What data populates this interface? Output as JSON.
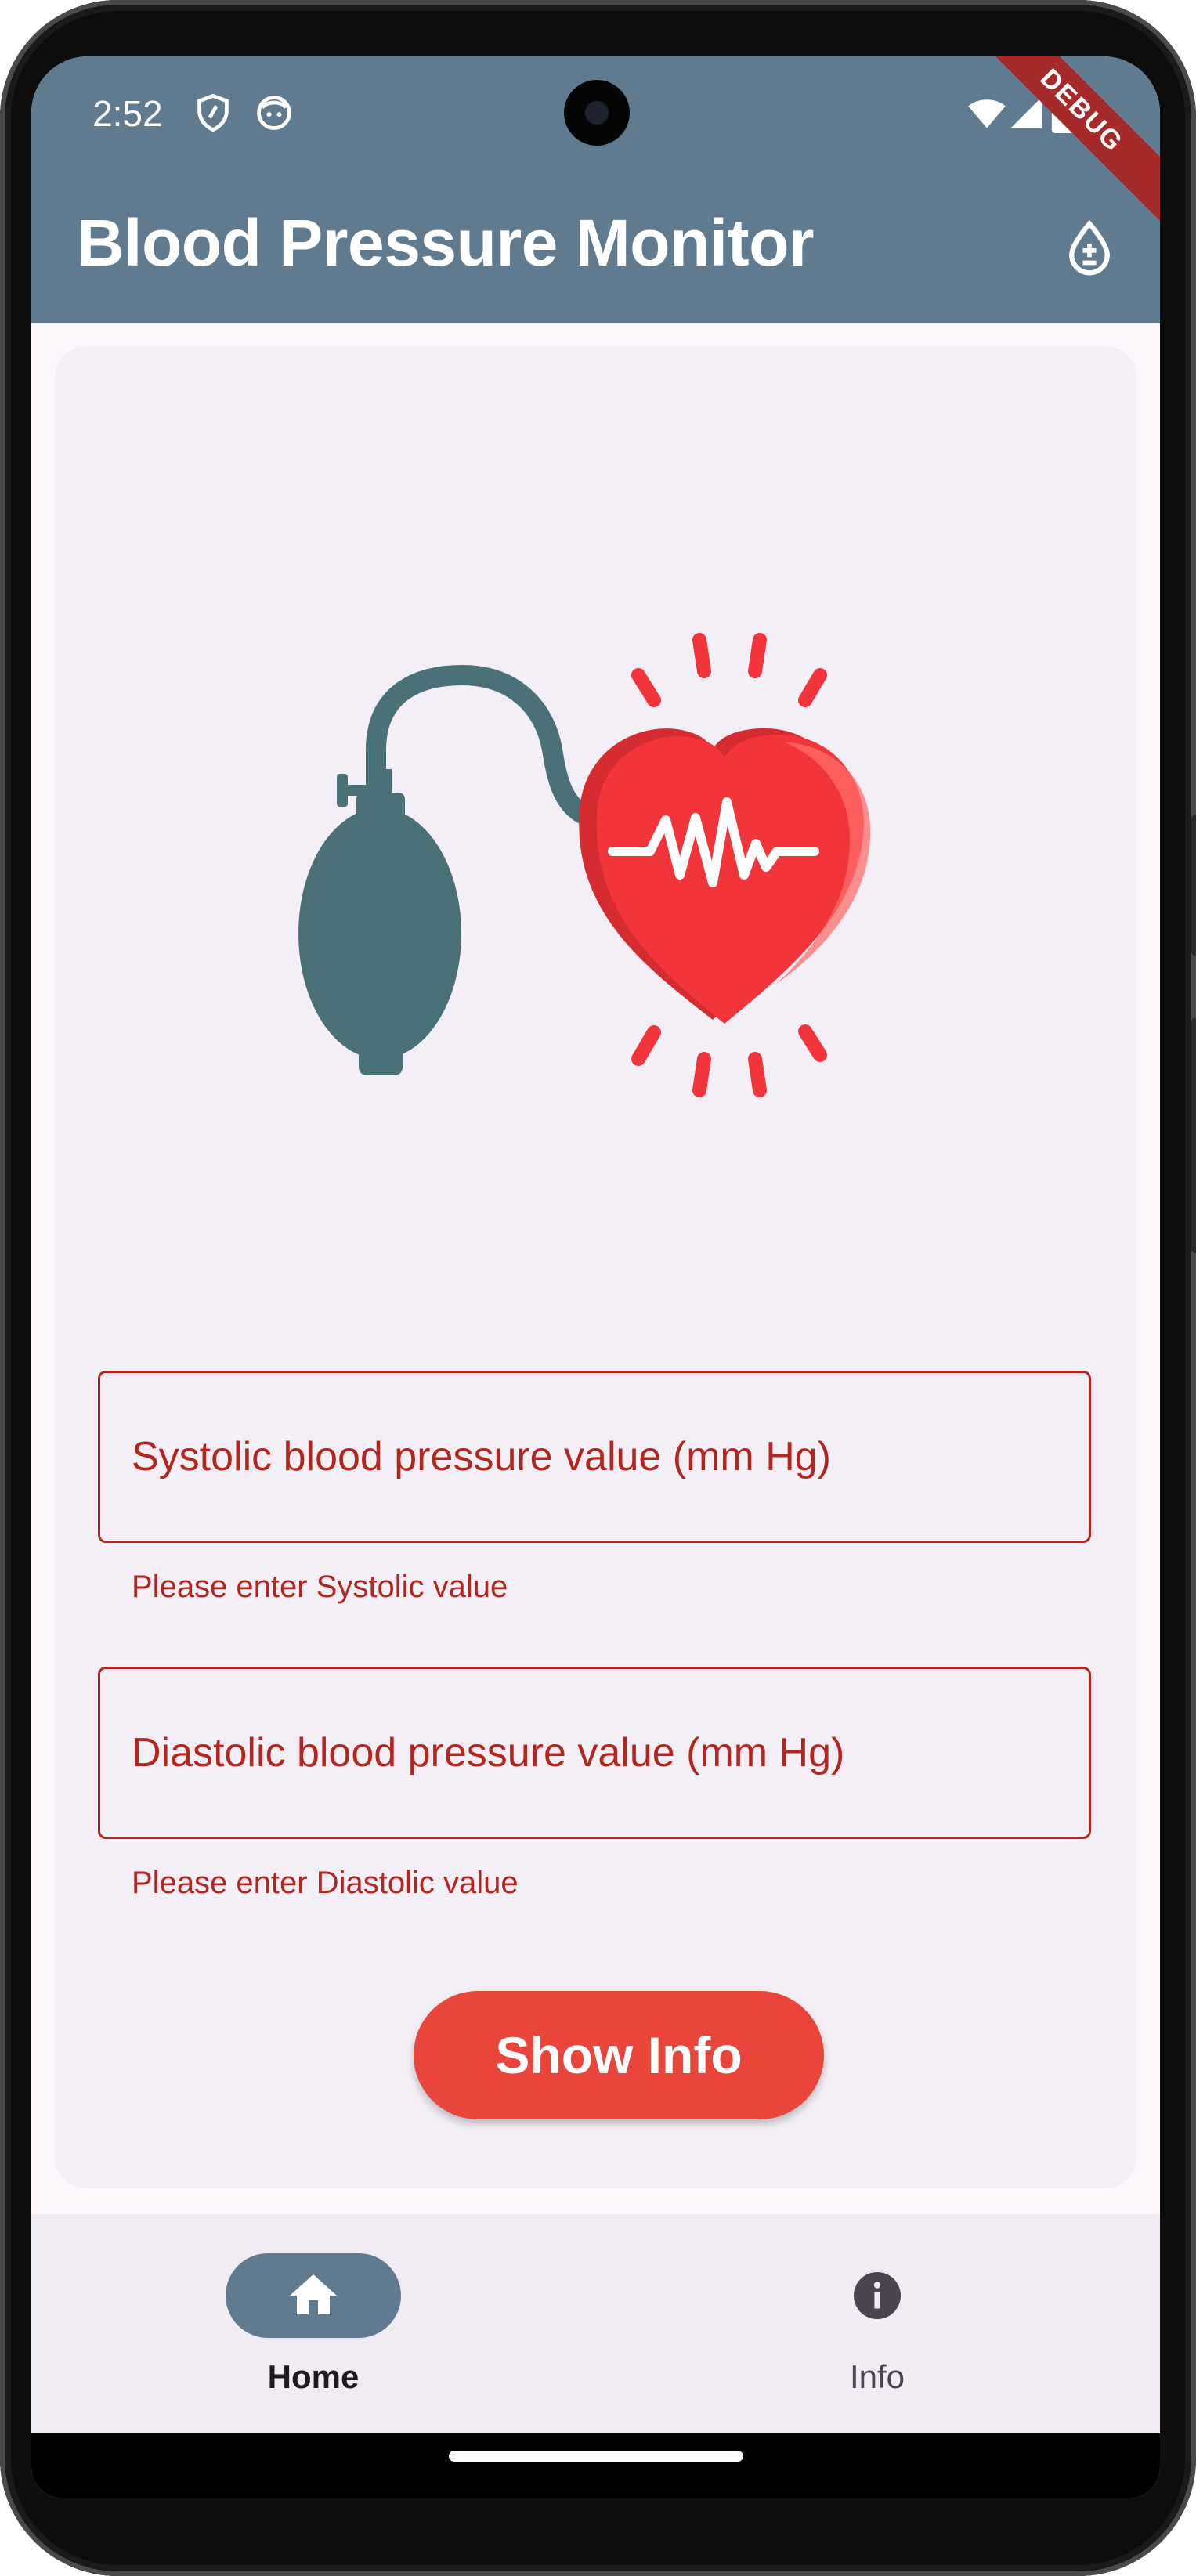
{
  "status_bar": {
    "time": "2:52",
    "left_icons": [
      "shield-icon",
      "face-icon"
    ],
    "right_icons": [
      "wifi-icon",
      "signal-icon",
      "battery-icon"
    ]
  },
  "debug_banner": "DEBUG",
  "app_bar": {
    "title": "Blood Pressure Monitor",
    "action_icon": "blood-drop-plus-minus-icon"
  },
  "illustration": {
    "subject": "blood pressure bulb connected to heart with heartbeat line",
    "colors": {
      "bulb": "#4b7178",
      "heart": "#f2353b",
      "heart_shadow": "#d42c31",
      "rays": "#f2353b"
    }
  },
  "form": {
    "systolic": {
      "placeholder": "Systolic blood pressure value (mm Hg)",
      "value": "",
      "error": "Please enter Systolic value"
    },
    "diastolic": {
      "placeholder": "Diastolic blood pressure value (mm Hg)",
      "value": "",
      "error": "Please enter Diastolic value"
    },
    "submit_label": "Show Info"
  },
  "bottom_nav": {
    "items": [
      {
        "label": "Home",
        "icon": "home-icon",
        "selected": true
      },
      {
        "label": "Info",
        "icon": "info-icon",
        "selected": false
      }
    ]
  },
  "colors": {
    "primary": "#607b8f",
    "error": "#b3261e",
    "button": "#e9453a",
    "surface": "#f4eff7"
  }
}
